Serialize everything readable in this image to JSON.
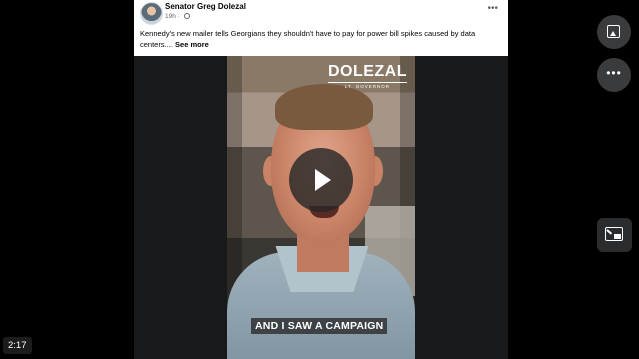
{
  "post": {
    "author": "Senator Greg Dolezal",
    "time": "19h",
    "caption": "Kennedy's new mailer tells Georgians they shouldn't have to pay for power bill spikes caused by data centers....",
    "see_more": "See more"
  },
  "video": {
    "brand_name": "DOLEZAL",
    "brand_sub": "LT. GOVERNOR",
    "subtitle": "AND I SAW A CAMPAIGN"
  },
  "player": {
    "timestamp": "2:17"
  },
  "icons": {
    "globe": "globe-icon",
    "more": "more-horizontal-icon",
    "photo": "image-icon",
    "pip": "picture-in-picture-icon",
    "play": "play-icon"
  }
}
